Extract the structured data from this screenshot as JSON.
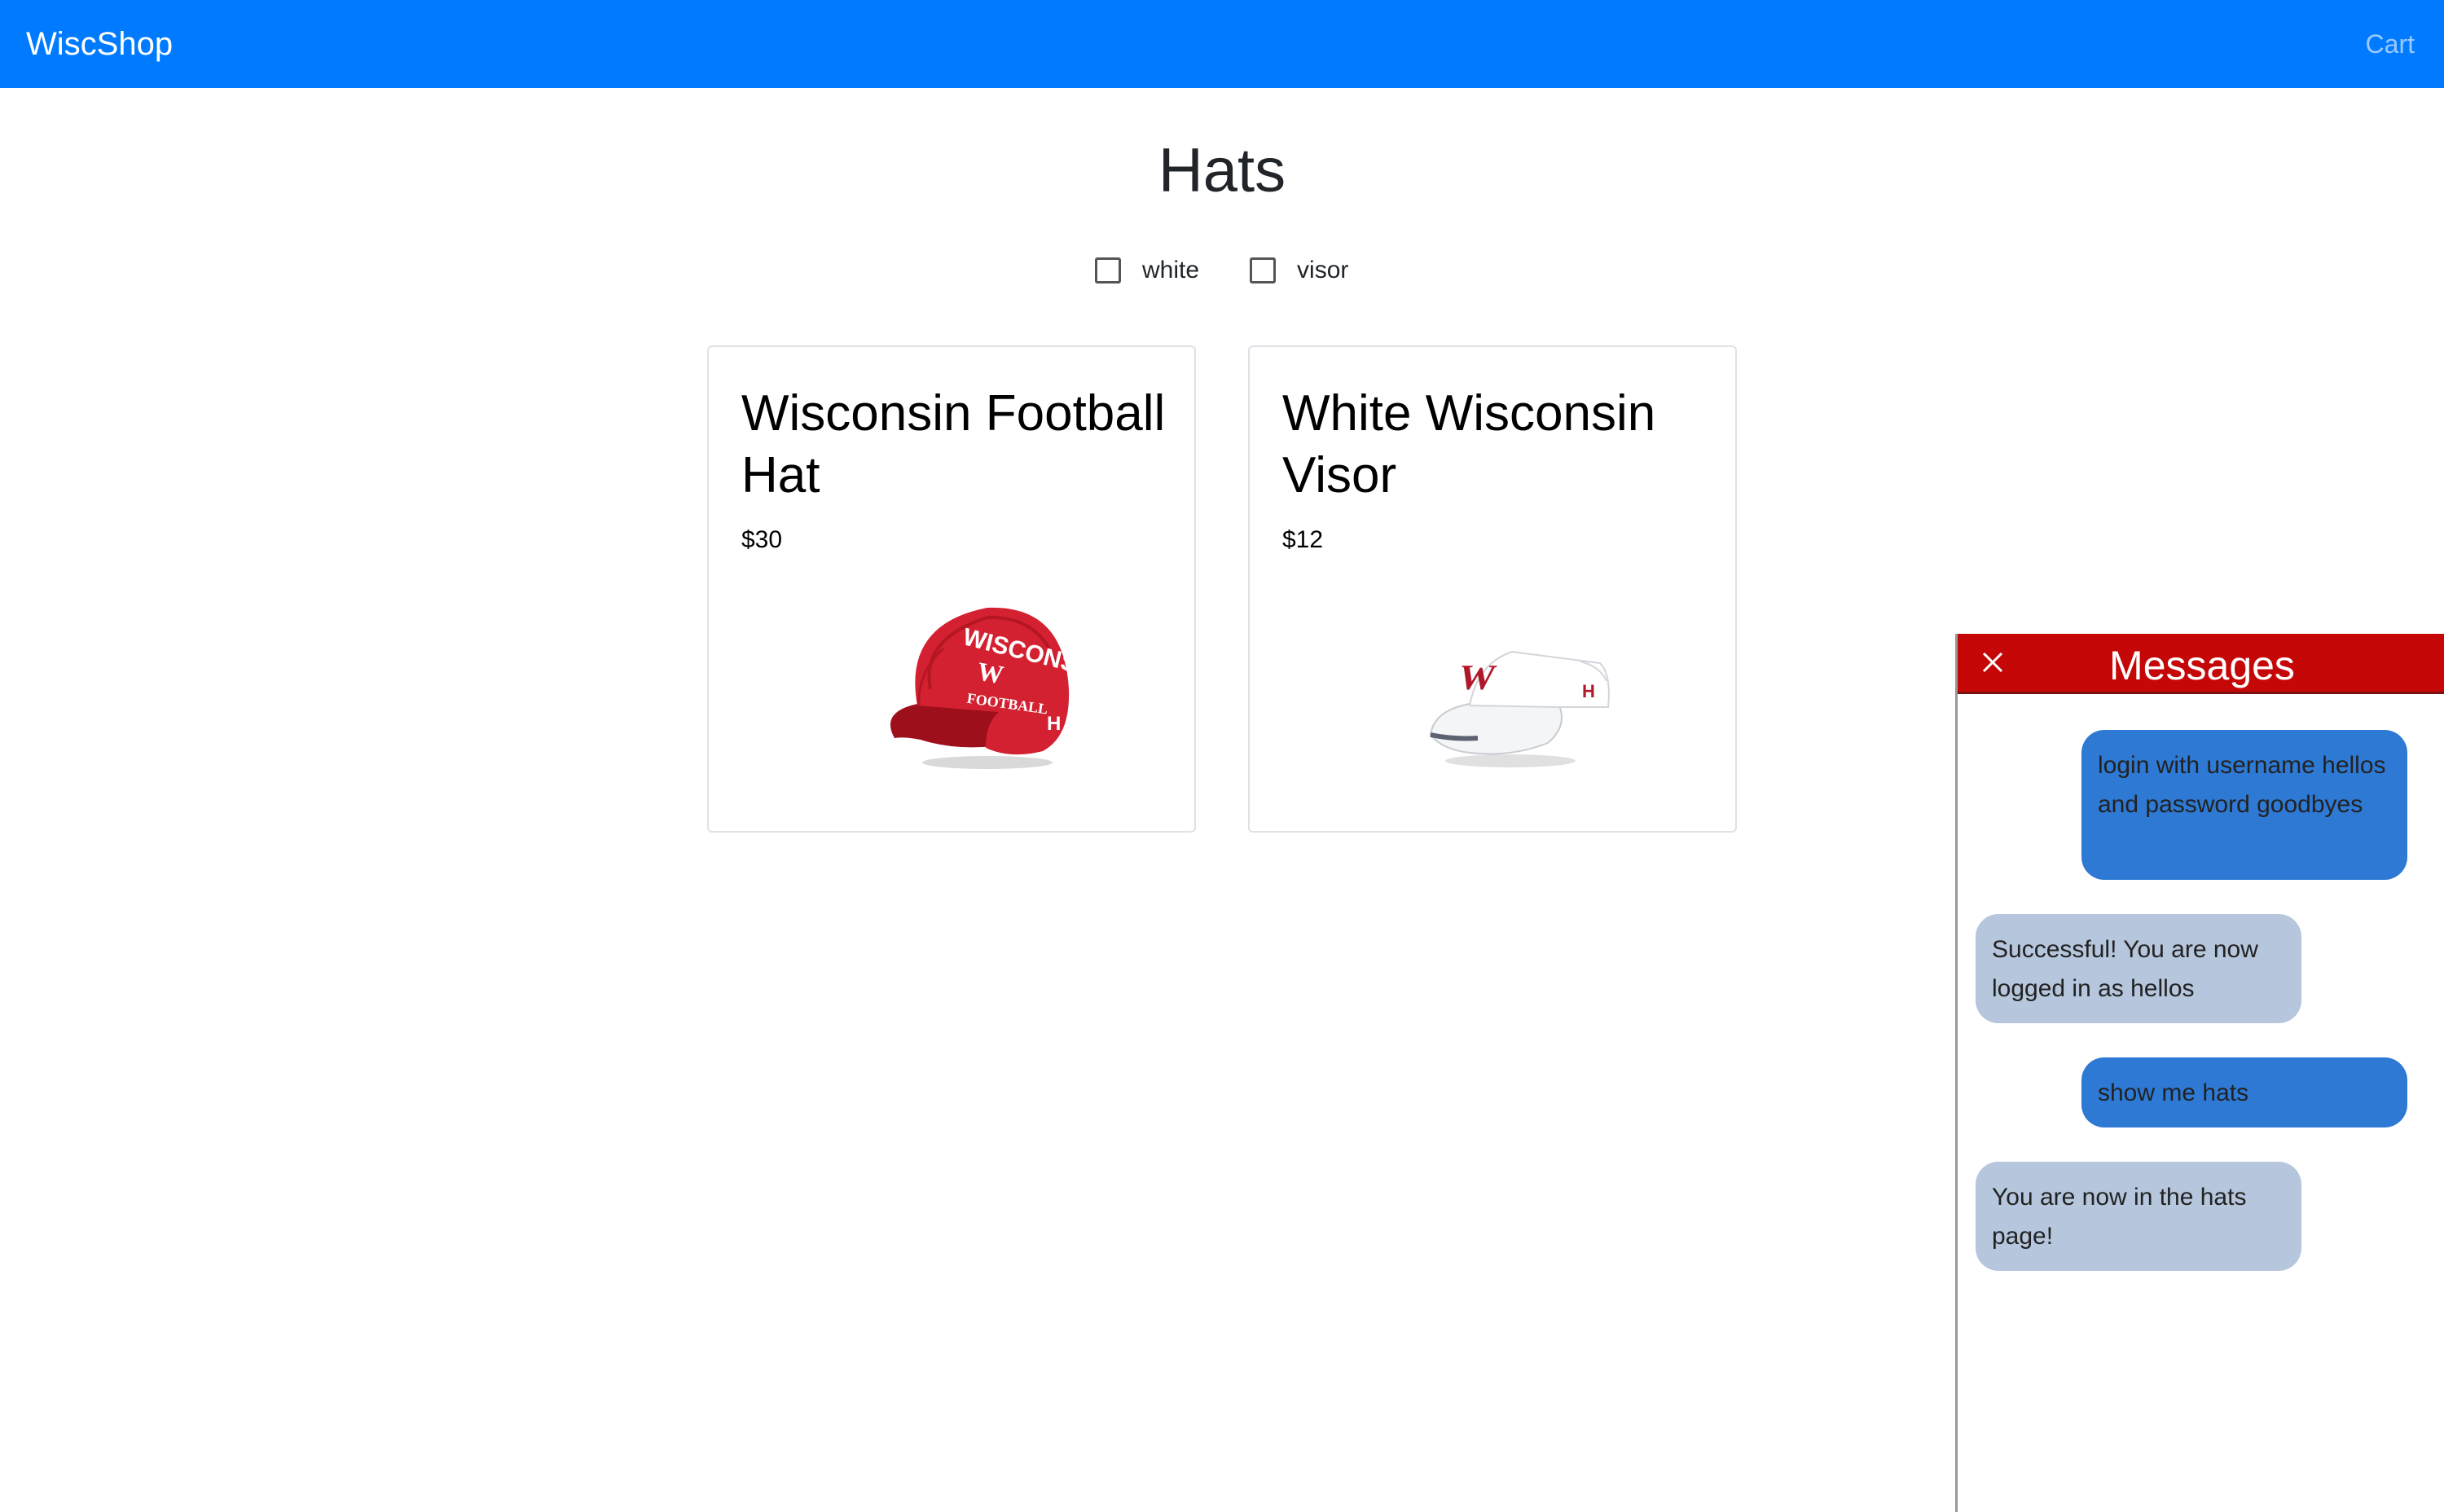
{
  "navbar": {
    "brand": "WiscShop",
    "cart_label": "Cart",
    "color": "#007bff"
  },
  "page": {
    "title": "Hats"
  },
  "filters": [
    {
      "label": "white",
      "checked": false
    },
    {
      "label": "visor",
      "checked": false
    }
  ],
  "products": [
    {
      "name": "Wisconsin Football Hat",
      "price": "$30",
      "image": "red-wisconsin-football-cap",
      "image_lettering": "WISCONSIN W FOOTBALL"
    },
    {
      "name": "White Wisconsin Visor",
      "price": "$12",
      "image": "white-wisconsin-visor"
    }
  ],
  "chat": {
    "title": "Messages",
    "header_color": "#c50707",
    "close_icon": "close-icon",
    "messages": [
      {
        "sender": "user",
        "text": "login with username hellos and password goodbyes"
      },
      {
        "sender": "bot",
        "text": "Successful! You are now logged in as hellos"
      },
      {
        "sender": "user",
        "text": "show me hats"
      },
      {
        "sender": "bot",
        "text": "You are now in the hats page!"
      }
    ]
  }
}
